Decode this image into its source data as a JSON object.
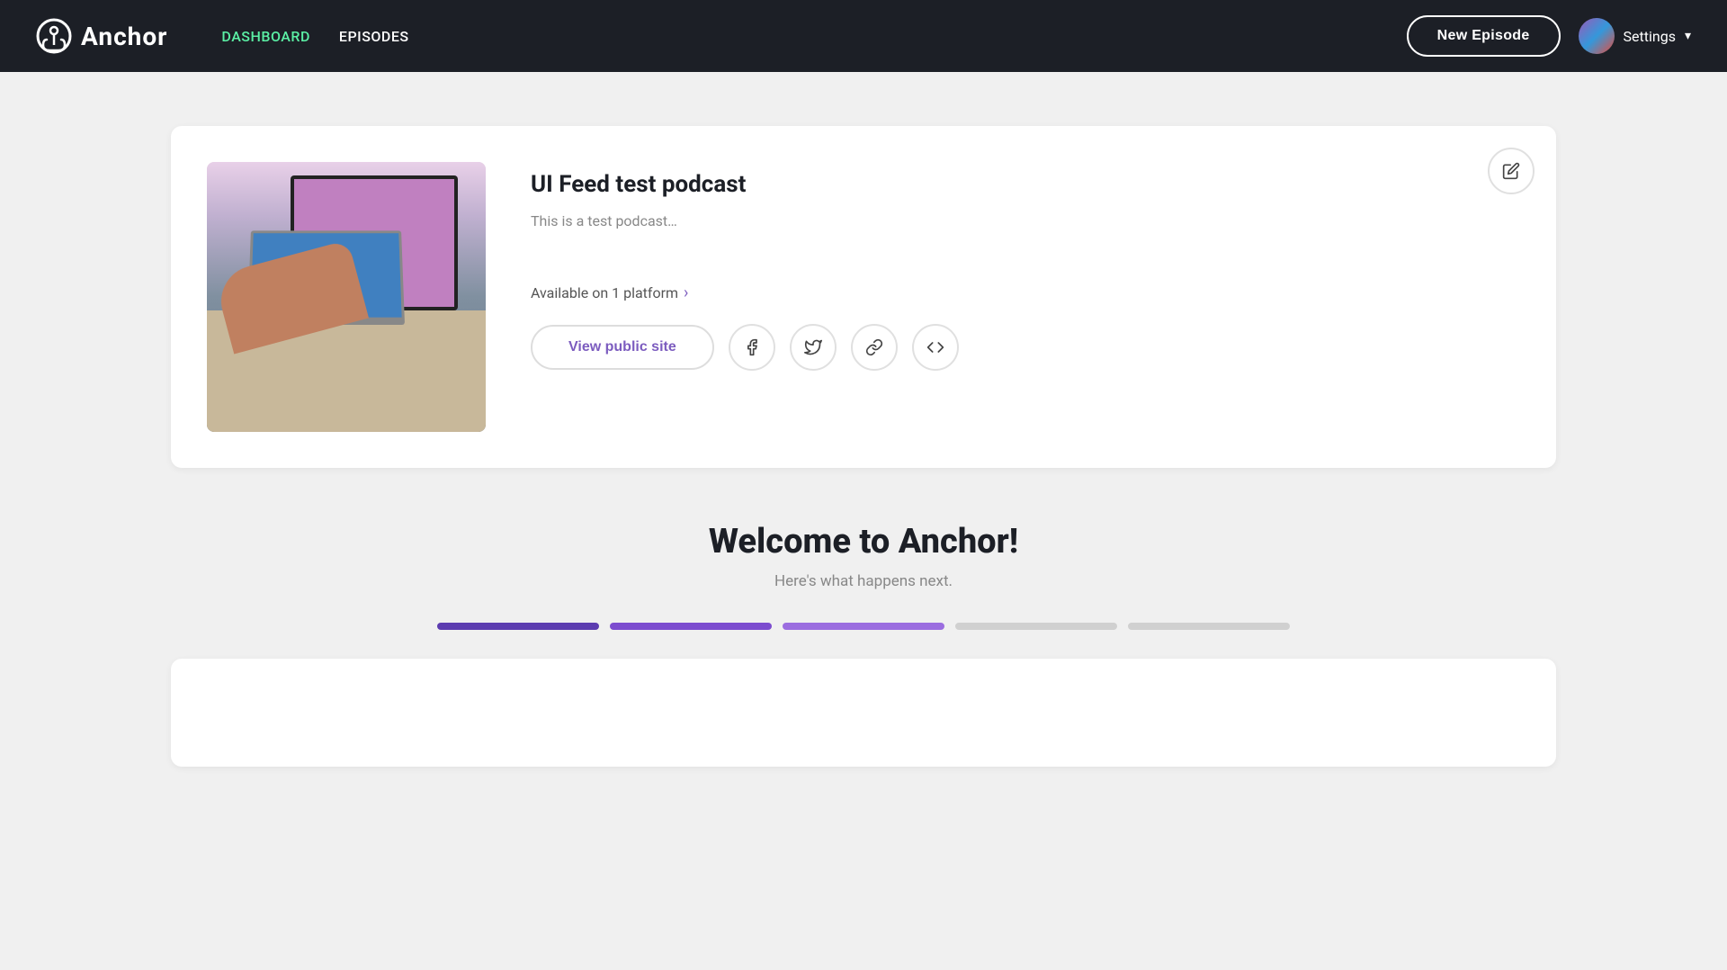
{
  "navbar": {
    "logo_text": "Anchor",
    "nav_links": [
      {
        "label": "DASHBOARD",
        "active": true
      },
      {
        "label": "EPISODES",
        "active": false
      }
    ],
    "new_episode_label": "New Episode",
    "settings_label": "Settings"
  },
  "podcast_card": {
    "title": "UI Feed test podcast",
    "description": "This is a test podcast…",
    "platform_text": "Available on 1 platform",
    "view_site_label": "View public site",
    "edit_icon": "✏",
    "facebook_icon": "f",
    "twitter_icon": "t",
    "link_icon": "🔗",
    "embed_icon": "<>"
  },
  "welcome_section": {
    "title": "Welcome to Anchor!",
    "subtitle": "Here's what happens next.",
    "progress": {
      "segments": [
        {
          "style": "filled-dark"
        },
        {
          "style": "filled-mid"
        },
        {
          "style": "filled-light"
        },
        {
          "style": "empty"
        },
        {
          "style": "empty"
        }
      ]
    }
  }
}
